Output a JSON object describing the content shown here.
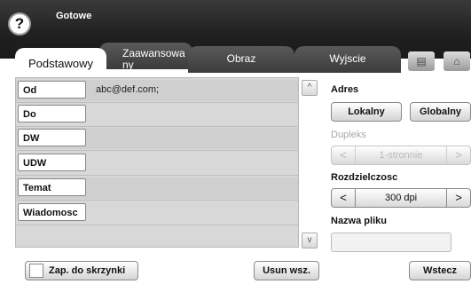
{
  "status": "Gotowe",
  "help_glyph": "?",
  "tabs": [
    "Podstawowy",
    "Zaawansowa ny",
    "Obraz",
    "Wyjscie"
  ],
  "header_icons": [
    "scan-to-box-icon",
    "home-icon"
  ],
  "address_rows": [
    {
      "label": "Od",
      "value": "abc@def.com;"
    },
    {
      "label": "Do",
      "value": ""
    },
    {
      "label": "DW",
      "value": ""
    },
    {
      "label": "UDW",
      "value": ""
    },
    {
      "label": "Temat",
      "value": ""
    },
    {
      "label": "Wiadomosc",
      "value": ""
    }
  ],
  "scroll_up_glyph": "^",
  "scroll_down_glyph": "v",
  "right": {
    "address_label": "Adres",
    "local_button": "Lokalny",
    "global_button": "Globalny",
    "duplex_label": "Dupleks",
    "duplex_value": "1-stronnie",
    "resolution_label": "Rozdzielczosc",
    "resolution_value": "300 dpi",
    "filename_label": "Nazwa pliku",
    "filename_value": ""
  },
  "bottom": {
    "save_to_box": "Zap. do skrzynki",
    "clear_all": "Usun wsz.",
    "back": "Wstecz"
  },
  "colors": {
    "header": "#222222",
    "tab_dark": "#4a4a4a",
    "row": "#d8d8d8"
  }
}
